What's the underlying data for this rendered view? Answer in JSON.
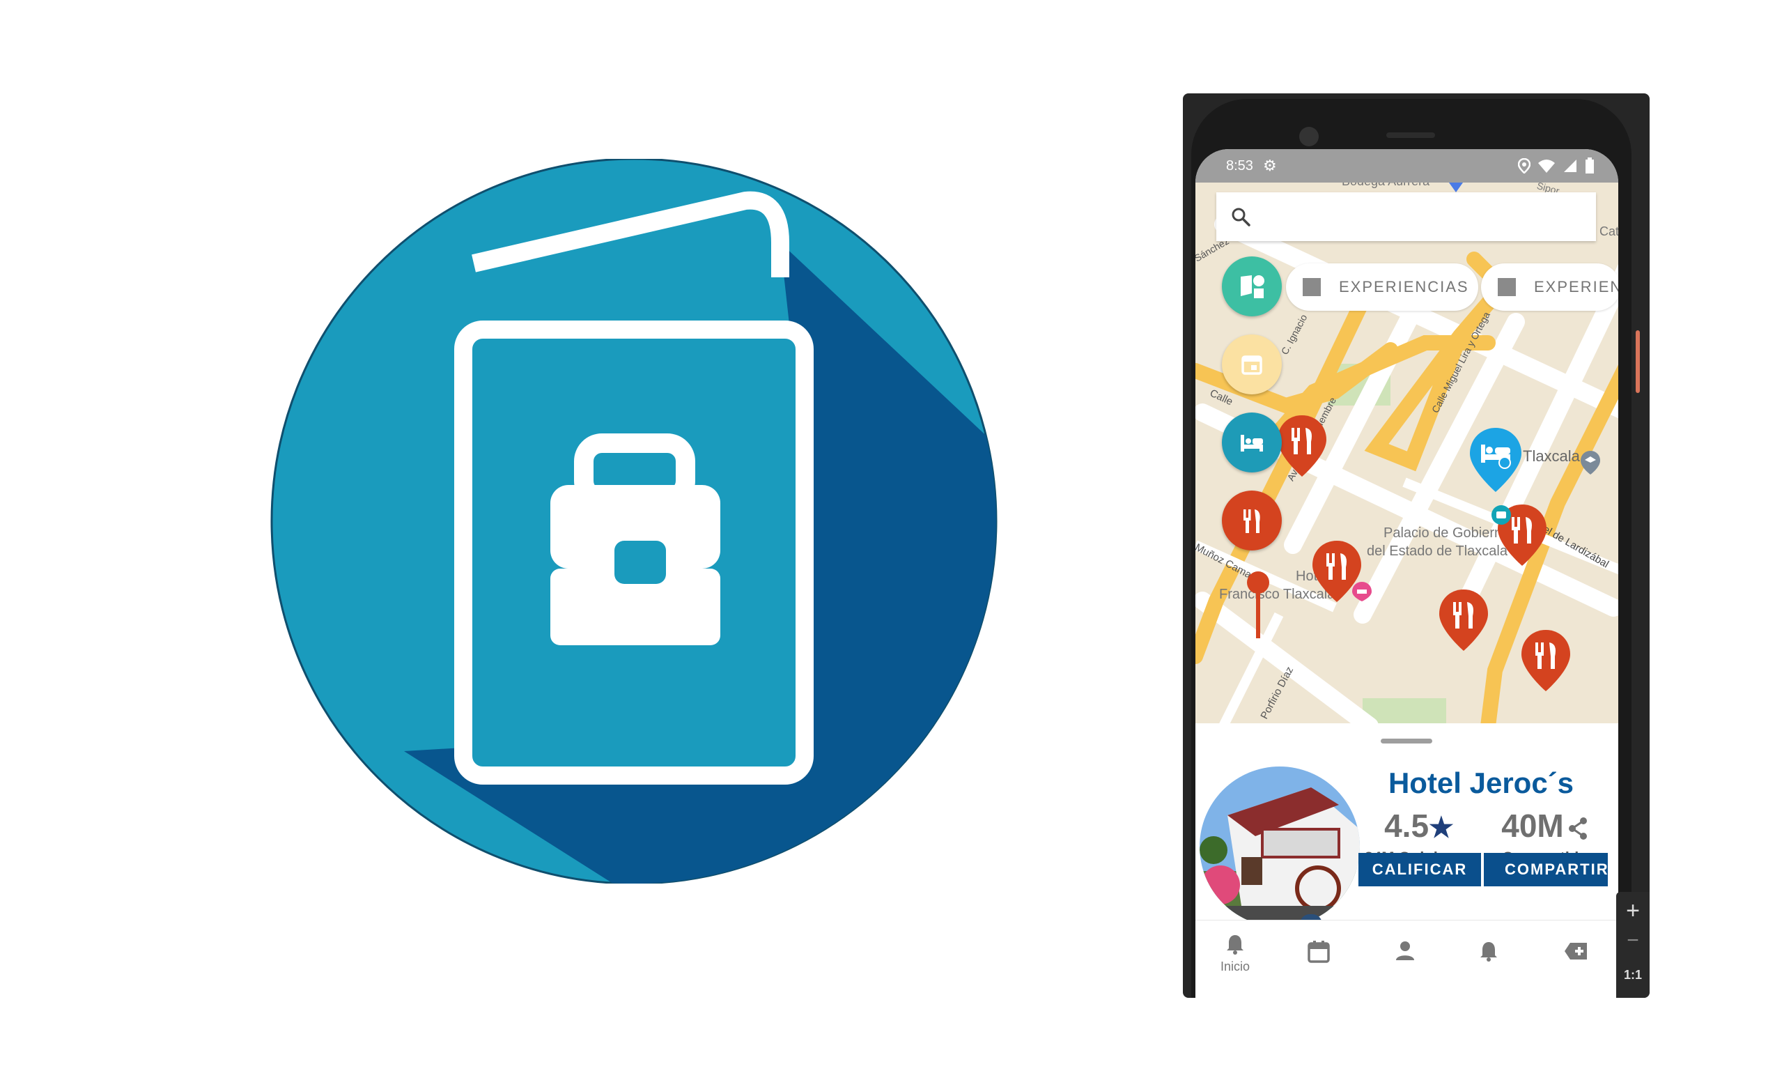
{
  "status_bar": {
    "time": "8:53"
  },
  "search": {
    "placeholder": ""
  },
  "chips": [
    {
      "label": "EXPERIENCIAS"
    },
    {
      "label": "EXPERIENCIAS"
    }
  ],
  "map_labels": {
    "top_street": "Bodega Aurrera",
    "top_right": "Sipor",
    "top_right_cat": "Cat",
    "sanchez": "Sánchez",
    "ignacio": "C. Ignacio",
    "miguel_lira": "Calle Miguel Lira y Ortega",
    "calle": "Calle",
    "noviembre": "Av. 16 de Septiembre",
    "tlaxcala": "Tlaxcala",
    "lardizabal": "Av. Miguel de Lardizábal",
    "munoz": "Muñoz Camargo",
    "palacio_1": "Palacio de Gobierno",
    "palacio_2": "del Estado de Tlaxcala",
    "hotel_1": "Hotel",
    "hotel_2": "Francisco Tlaxcala",
    "porfirio": "Porfirio Díaz"
  },
  "hotel": {
    "name": "Hotel Jeroc´s",
    "rating": "4.5",
    "rating_star": "★",
    "opinions": "34M Opiniones",
    "shares": "40M",
    "shares_label": "Compartido",
    "rate_button": "CALIFICAR",
    "share_button": "COMPARTIR"
  },
  "bottom_nav": [
    {
      "label": "Inicio",
      "icon": "bell-icon"
    },
    {
      "label": "",
      "icon": "calendar-icon"
    },
    {
      "label": "",
      "icon": "person-icon"
    },
    {
      "label": "",
      "icon": "bell-icon"
    },
    {
      "label": "",
      "icon": "add-tag-icon"
    }
  ],
  "zoom": {
    "plus": "+",
    "minus": "−",
    "ratio": "1:1"
  },
  "colors": {
    "logo_circle": "#1a9bbd",
    "logo_shadow": "#08568e",
    "accent": "#0a4f8c",
    "pin_red": "#d4431f",
    "pin_blue": "#1ca4e4"
  }
}
